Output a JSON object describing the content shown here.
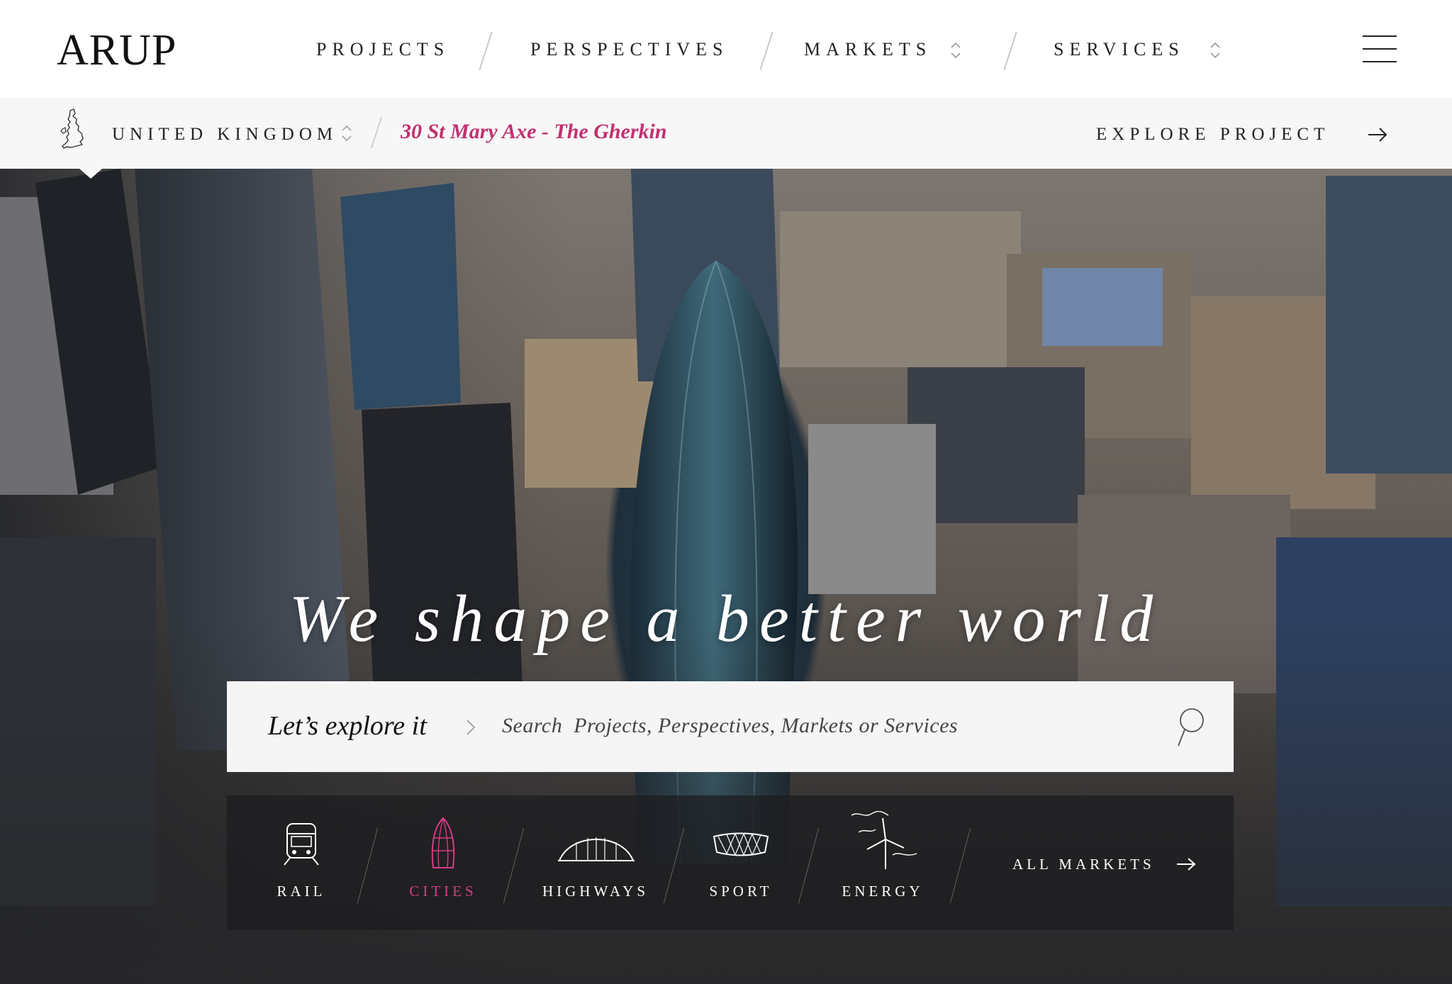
{
  "brand": {
    "logo_text": "ARUP"
  },
  "nav": {
    "items": [
      {
        "label": "PROJECTS",
        "has_dropdown": false
      },
      {
        "label": "PERSPECTIVES",
        "has_dropdown": false
      },
      {
        "label": "MARKETS",
        "has_dropdown": true
      },
      {
        "label": "SERVICES",
        "has_dropdown": true
      }
    ],
    "menu_icon": "hamburger-menu-icon"
  },
  "subbar": {
    "country": "UNITED KINGDOM",
    "project": "30 St Mary Axe - The Gherkin",
    "explore_label": "EXPLORE PROJECT",
    "accent_color": "#c2306f"
  },
  "hero": {
    "tagline": "We shape a better world",
    "search": {
      "lead": "Let’s explore it",
      "placeholder": "Search  Projects, Perspectives, Markets or Services"
    },
    "markets": [
      {
        "label": "RAIL",
        "icon": "train-icon",
        "active": false
      },
      {
        "label": "CITIES",
        "icon": "gherkin-building-icon",
        "active": true
      },
      {
        "label": "HIGHWAYS",
        "icon": "bridge-icon",
        "active": false
      },
      {
        "label": "SPORT",
        "icon": "stadium-icon",
        "active": false
      },
      {
        "label": "ENERGY",
        "icon": "wind-turbine-icon",
        "active": false
      }
    ],
    "all_markets_label": "ALL MARKETS",
    "active_color": "#d73b86"
  }
}
